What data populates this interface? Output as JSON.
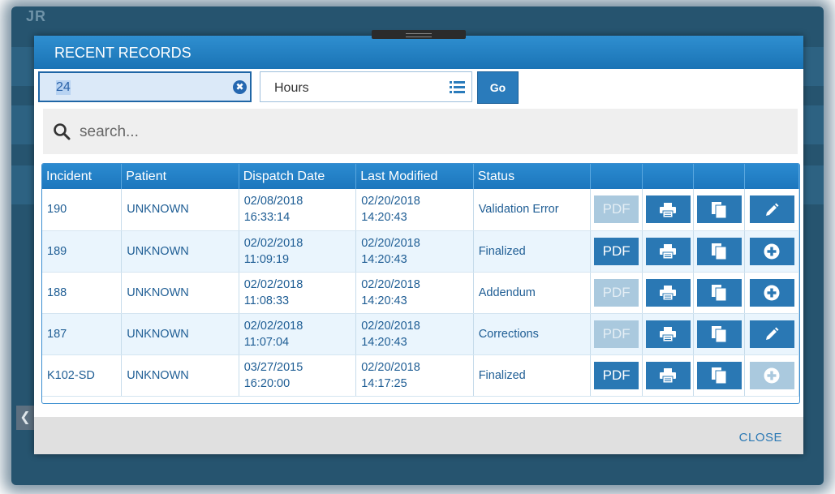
{
  "background": {
    "title": "JR"
  },
  "modal": {
    "title": "RECENT RECORDS",
    "filter": {
      "amount": "24",
      "unit": "Hours",
      "go_label": "Go"
    },
    "search": {
      "placeholder": "search..."
    },
    "table": {
      "headers": [
        "Incident",
        "Patient",
        "Dispatch Date",
        "Last Modified",
        "Status",
        "",
        "",
        "",
        ""
      ],
      "rows": [
        {
          "incident": "190",
          "patient": "UNKNOWN",
          "dispatch_date": "02/08/2018",
          "dispatch_time": "16:33:14",
          "modified_date": "02/20/2018",
          "modified_time": "14:20:43",
          "status": "Validation Error",
          "pdf_enabled": false,
          "last_action": "pencil-icon",
          "last_action_enabled": true
        },
        {
          "incident": "189",
          "patient": "UNKNOWN",
          "dispatch_date": "02/02/2018",
          "dispatch_time": "11:09:19",
          "modified_date": "02/20/2018",
          "modified_time": "14:20:43",
          "status": "Finalized",
          "pdf_enabled": true,
          "last_action": "plus-circle-icon",
          "last_action_enabled": true
        },
        {
          "incident": "188",
          "patient": "UNKNOWN",
          "dispatch_date": "02/02/2018",
          "dispatch_time": "11:08:33",
          "modified_date": "02/20/2018",
          "modified_time": "14:20:43",
          "status": "Addendum",
          "pdf_enabled": false,
          "last_action": "plus-circle-icon",
          "last_action_enabled": true
        },
        {
          "incident": "187",
          "patient": "UNKNOWN",
          "dispatch_date": "02/02/2018",
          "dispatch_time": "11:07:04",
          "modified_date": "02/20/2018",
          "modified_time": "14:20:43",
          "status": "Corrections",
          "pdf_enabled": false,
          "last_action": "pencil-icon",
          "last_action_enabled": true
        },
        {
          "incident": "K102-SD",
          "patient": "UNKNOWN",
          "dispatch_date": "03/27/2015",
          "dispatch_time": "16:20:00",
          "modified_date": "02/20/2018",
          "modified_time": "14:17:25",
          "status": "Finalized",
          "pdf_enabled": true,
          "last_action": "plus-circle-icon",
          "last_action_enabled": false
        }
      ],
      "pdf_label": "PDF"
    },
    "close_label": "CLOSE"
  },
  "colors": {
    "header_blue": "#1c76bd",
    "button_blue": "#2a78b4",
    "button_disabled": "#aac9de",
    "text_blue": "#1e5d94"
  }
}
